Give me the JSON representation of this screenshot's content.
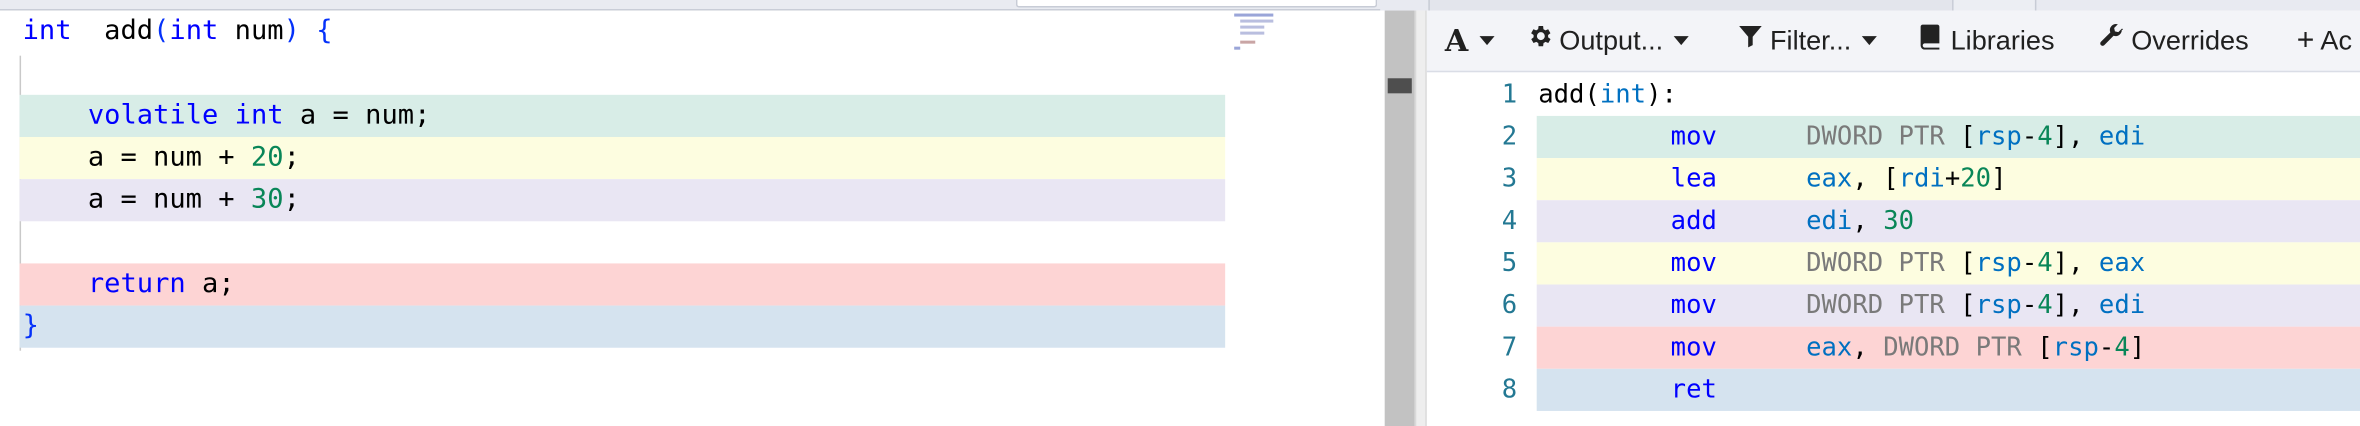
{
  "colors": {
    "green": "#d8ede7",
    "yellow": "#fdfde0",
    "purple": "#e9e6f3",
    "red": "#fdd4d4",
    "blue": "#d5e3ef"
  },
  "editor": {
    "lines": [
      {
        "parts": [
          [
            "kw",
            "int"
          ],
          [
            "",
            "  add"
          ],
          [
            "brace",
            "("
          ],
          [
            "kw",
            "int"
          ],
          [
            "",
            " num"
          ],
          [
            "brace",
            ")"
          ],
          [
            "",
            " "
          ],
          [
            "brace",
            "{"
          ]
        ],
        "bg": ""
      },
      {
        "parts": [],
        "bg": ""
      },
      {
        "parts": [
          [
            "",
            "    "
          ],
          [
            "kw",
            "volatile"
          ],
          [
            "",
            " "
          ],
          [
            "kw",
            "int"
          ],
          [
            "",
            " a = num;"
          ]
        ],
        "bg": "green"
      },
      {
        "parts": [
          [
            "",
            "    a = num + "
          ],
          [
            "num",
            "20"
          ],
          [
            "",
            ";"
          ]
        ],
        "bg": "yellow"
      },
      {
        "parts": [
          [
            "",
            "    a = num + "
          ],
          [
            "num",
            "30"
          ],
          [
            "",
            ";"
          ]
        ],
        "bg": "purple"
      },
      {
        "parts": [],
        "bg": ""
      },
      {
        "parts": [
          [
            "",
            "    "
          ],
          [
            "kw",
            "return"
          ],
          [
            "",
            " a;"
          ]
        ],
        "bg": "red"
      },
      {
        "parts": [
          [
            "brace",
            "}"
          ]
        ],
        "bg": "blue"
      }
    ]
  },
  "toolbar": {
    "font_icon": "font-size-icon",
    "font_label": "A",
    "output_icon": "gear-icon",
    "output_label": "Output...",
    "filter_icon": "filter-icon",
    "filter_label": "Filter...",
    "libraries_icon": "book-icon",
    "libraries_label": "Libraries",
    "overrides_icon": "wrench-icon",
    "overrides_label": "Overrides",
    "add_icon": "plus-icon",
    "add_label": "Ac"
  },
  "assembly": [
    {
      "line": "1",
      "label": "add(int):",
      "op": "",
      "args": "",
      "bg": ""
    },
    {
      "line": "2",
      "label": "",
      "op": "mov",
      "args": "DWORD PTR [rsp-4], edi",
      "bg": "green"
    },
    {
      "line": "3",
      "label": "",
      "op": "lea",
      "args": "eax, [rdi+20]",
      "bg": "yellow"
    },
    {
      "line": "4",
      "label": "",
      "op": "add",
      "args": "edi, 30",
      "bg": "purple"
    },
    {
      "line": "5",
      "label": "",
      "op": "mov",
      "args": "DWORD PTR [rsp-4], eax",
      "bg": "yellow"
    },
    {
      "line": "6",
      "label": "",
      "op": "mov",
      "args": "DWORD PTR [rsp-4], edi",
      "bg": "purple"
    },
    {
      "line": "7",
      "label": "",
      "op": "mov",
      "args": "eax, DWORD PTR [rsp-4]",
      "bg": "red"
    },
    {
      "line": "8",
      "label": "",
      "op": "ret",
      "args": "",
      "bg": "blue"
    }
  ]
}
